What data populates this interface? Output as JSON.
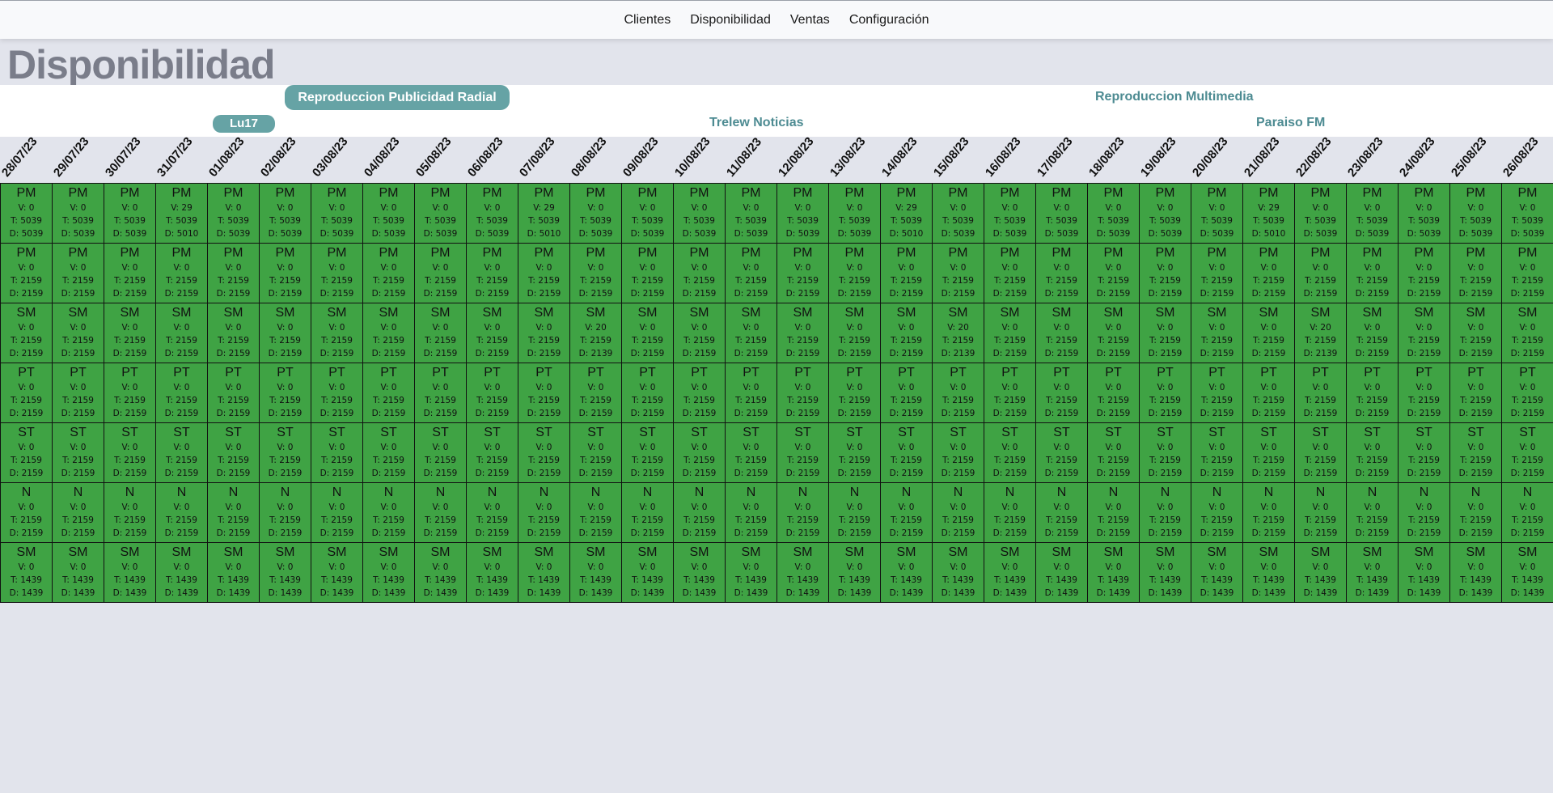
{
  "nav": {
    "items": [
      "Clientes",
      "Disponibilidad",
      "Ventas",
      "Configuración"
    ]
  },
  "page": {
    "title": "Disponibilidad"
  },
  "header": {
    "campaign_button": "Reproduccion Publicidad Radial",
    "day_badge": "Lu17",
    "media_label": "Reproduccion Multimedia",
    "station_1": "Trelew Noticias",
    "station_2": "Paraiso FM"
  },
  "dates": [
    "28/07/23",
    "29/07/23",
    "30/07/23",
    "31/07/23",
    "01/08/23",
    "02/08/23",
    "03/08/23",
    "04/08/23",
    "05/08/23",
    "06/08/23",
    "07/08/23",
    "08/08/23",
    "09/08/23",
    "10/08/23",
    "11/08/23",
    "12/08/23",
    "13/08/23",
    "14/08/23",
    "15/08/23",
    "16/08/23",
    "17/08/23",
    "18/08/23",
    "19/08/23",
    "20/08/23",
    "21/08/23",
    "22/08/23",
    "23/08/23",
    "24/08/23",
    "25/08/23",
    "26/08/23"
  ],
  "colors": {
    "cell_available": "#3fa344",
    "accent": "#66a3a5",
    "header_text": "#4d8b92"
  },
  "rows": [
    {
      "code": "PM",
      "default": {
        "v": "V: 0",
        "t": "T: 5039",
        "d": "D: 5039"
      },
      "overrides": {
        "3": {
          "v": "V: 29",
          "t": "T: 5039",
          "d": "D: 5010"
        },
        "10": {
          "v": "V: 29",
          "t": "T: 5039",
          "d": "D: 5010"
        },
        "17": {
          "v": "V: 29",
          "t": "T: 5039",
          "d": "D: 5010"
        },
        "24": {
          "v": "V: 29",
          "t": "T: 5039",
          "d": "D: 5010"
        }
      }
    },
    {
      "code": "PM",
      "default": {
        "v": "V: 0",
        "t": "T: 2159",
        "d": "D: 2159"
      },
      "overrides": {}
    },
    {
      "code": "SM",
      "default": {
        "v": "V: 0",
        "t": "T: 2159",
        "d": "D: 2159"
      },
      "overrides": {
        "11": {
          "v": "V: 20",
          "t": "T: 2159",
          "d": "D: 2139"
        },
        "18": {
          "v": "V: 20",
          "t": "T: 2159",
          "d": "D: 2139"
        },
        "25": {
          "v": "V: 20",
          "t": "T: 2159",
          "d": "D: 2139"
        }
      }
    },
    {
      "code": "PT",
      "default": {
        "v": "V: 0",
        "t": "T: 2159",
        "d": "D: 2159"
      },
      "overrides": {}
    },
    {
      "code": "ST",
      "default": {
        "v": "V: 0",
        "t": "T: 2159",
        "d": "D: 2159"
      },
      "overrides": {}
    },
    {
      "code": "N",
      "default": {
        "v": "V: 0",
        "t": "T: 2159",
        "d": "D: 2159"
      },
      "overrides": {}
    },
    {
      "code": "SM",
      "default": {
        "v": "V: 0",
        "t": "T: 1439",
        "d": "D: 1439"
      },
      "overrides": {}
    }
  ]
}
